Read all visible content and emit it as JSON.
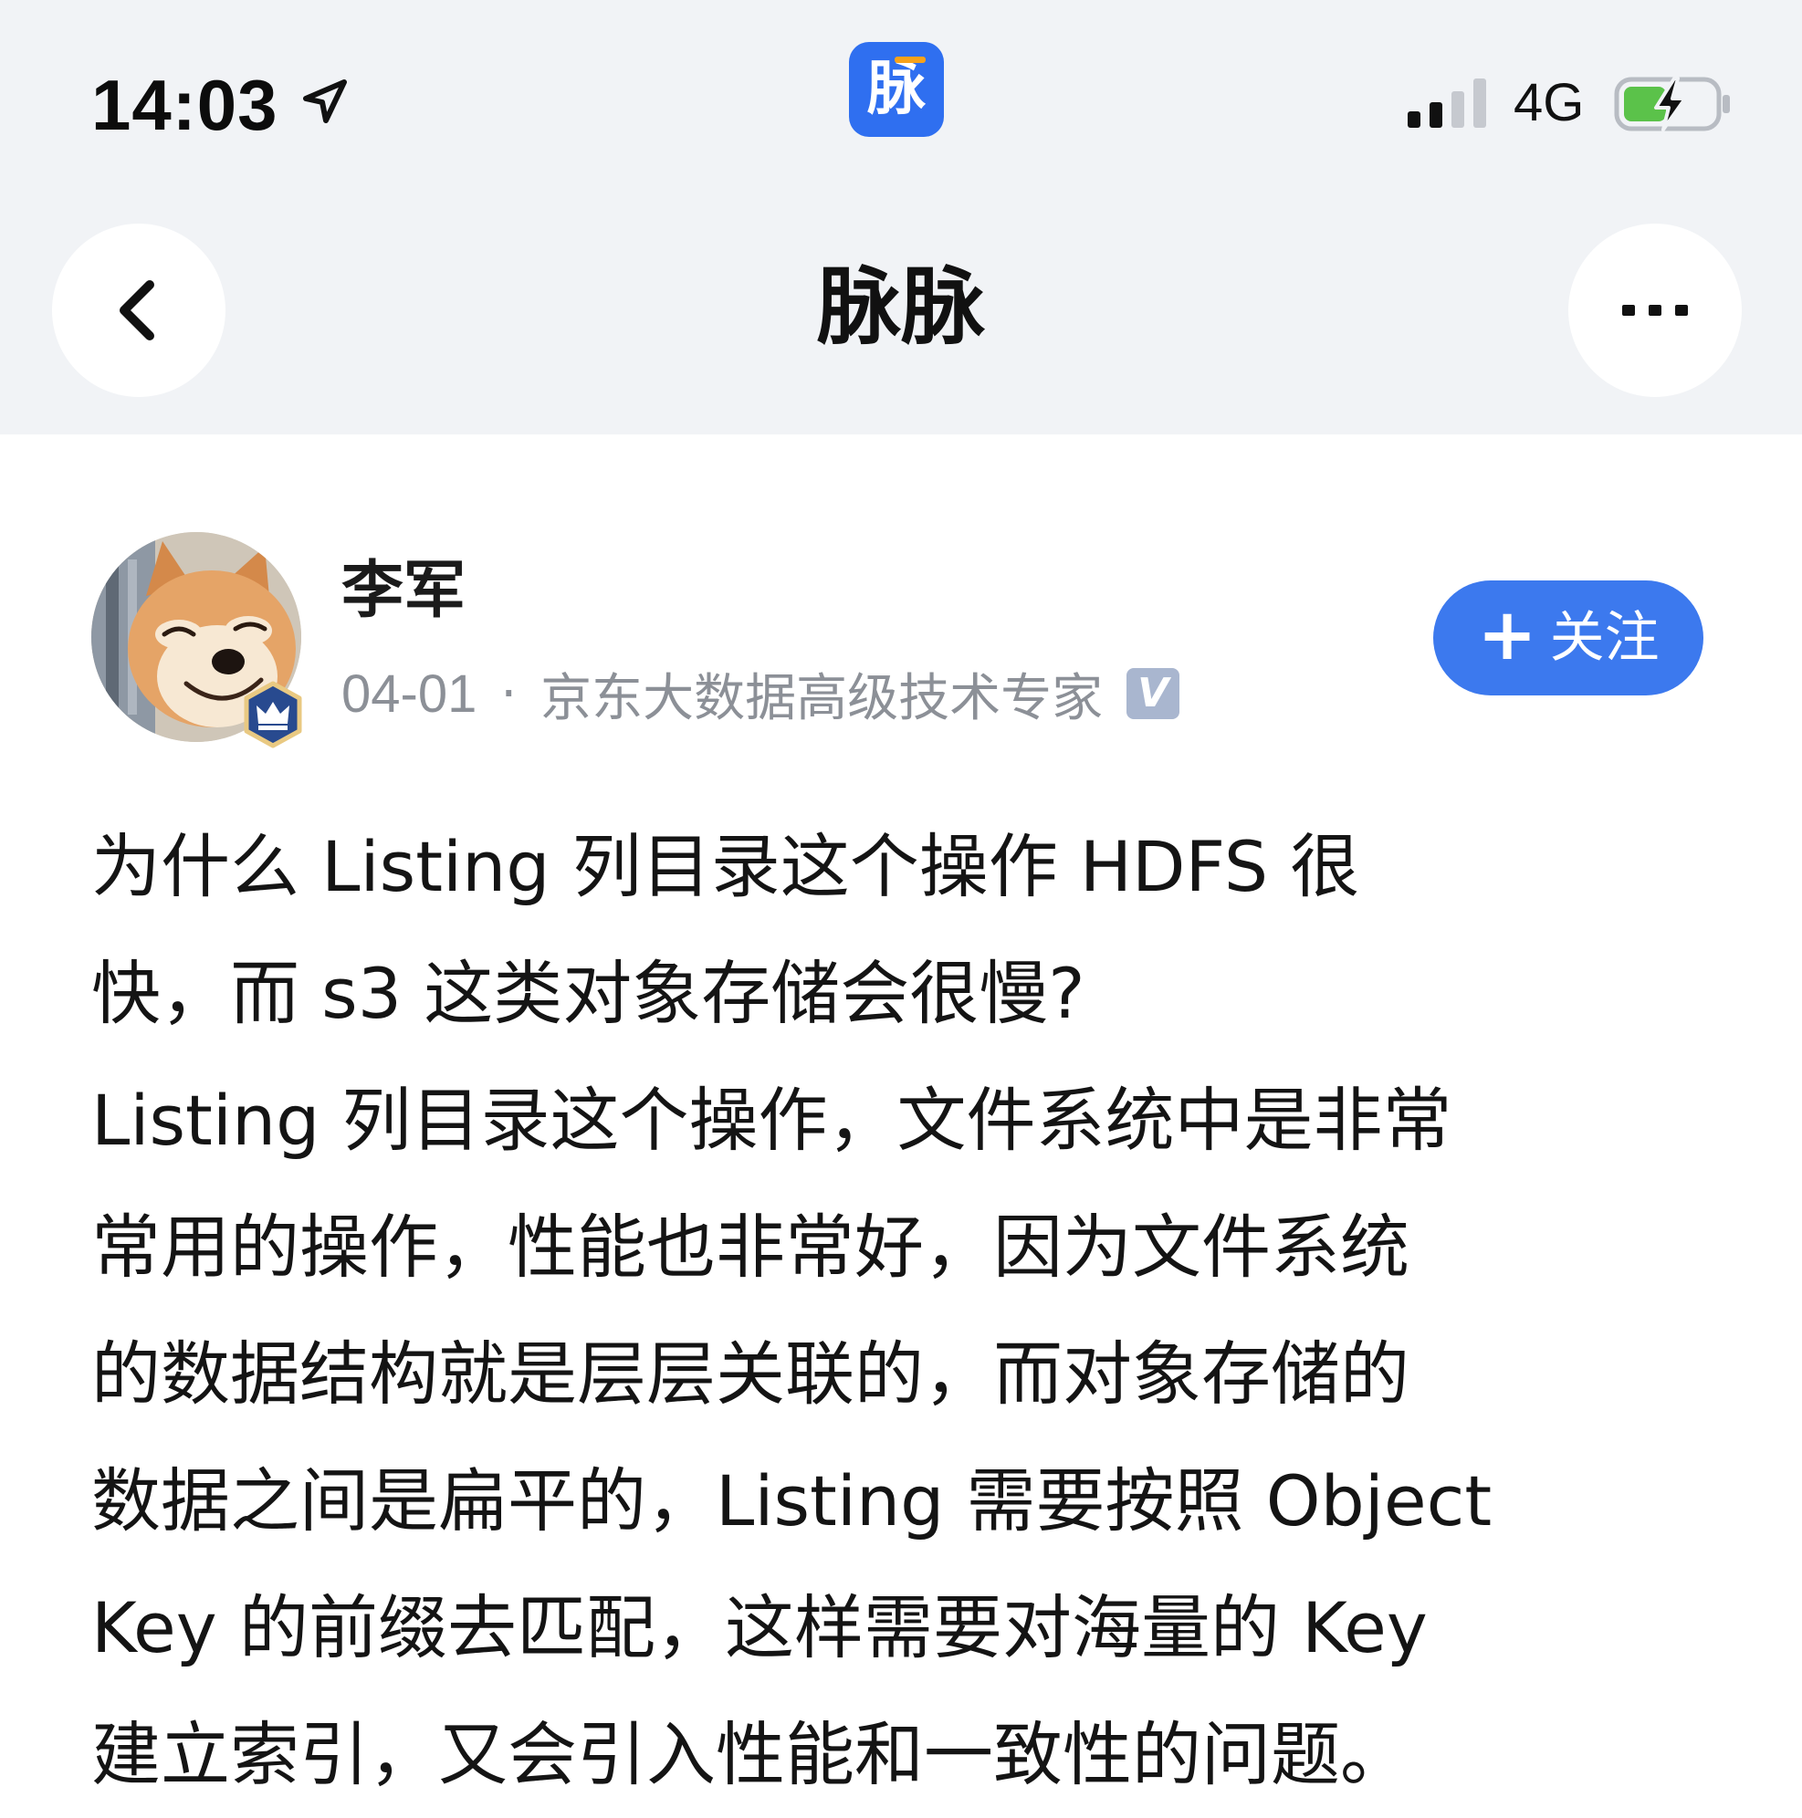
{
  "status_bar": {
    "time": "14:03",
    "network": "4G",
    "icons": [
      "location-arrow-icon",
      "cellular-signal-icon",
      "battery-charging-icon"
    ]
  },
  "app_logo": {
    "glyph": "脉",
    "color": "#2f6ff0"
  },
  "nav": {
    "title": "脉脉",
    "back_icon": "chevron-left-icon",
    "more_icon": "ellipsis-icon"
  },
  "author": {
    "name": "李军",
    "date": "04-01",
    "separator": "·",
    "title": "京东大数据高级技术专家",
    "verified_mark": "V",
    "badge_icon": "crown-badge-icon"
  },
  "follow_button": {
    "icon": "plus-icon",
    "label": "关注",
    "color": "#3c79ee"
  },
  "post": {
    "lines": [
      "为什么 Listing 列目录这个操作 HDFS 很",
      "快，而 s3 这类对象存储会很慢?",
      "Listing 列目录这个操作，文件系统中是非常",
      "常用的操作，性能也非常好，因为文件系统",
      "的数据结构就是层层关联的，而对象存储的",
      "数据之间是扁平的，Listing 需要按照 Object",
      "Key 的前缀去匹配，这样需要对海量的 Key",
      "建立索引，又会引入性能和一致性的问题。"
    ]
  }
}
